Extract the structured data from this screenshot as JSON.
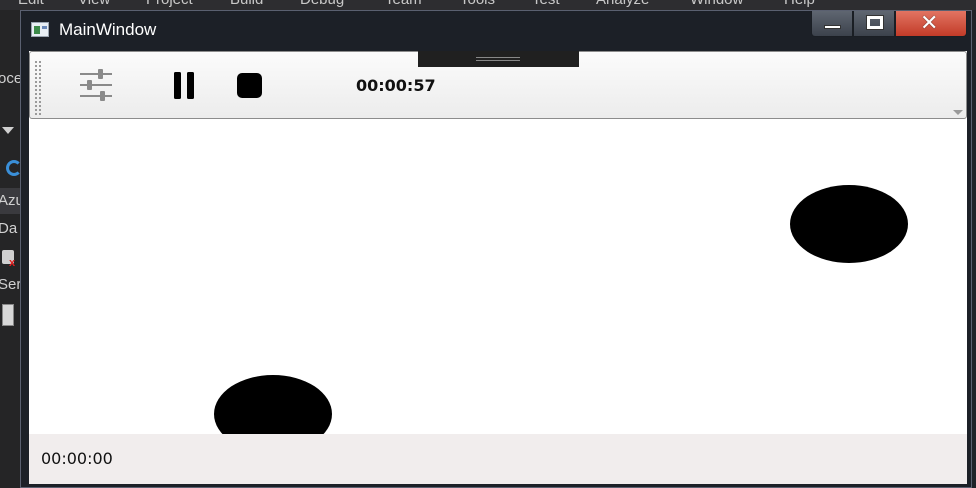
{
  "ide": {
    "menu": [
      "Edit",
      "View",
      "Project",
      "Build",
      "Debug",
      "Team",
      "Tools",
      "Test",
      "Analyze",
      "Window",
      "Help"
    ],
    "left_panel": [
      "oce",
      "Azu",
      "Da",
      "Ser"
    ]
  },
  "window": {
    "title": "MainWindow",
    "icons": {
      "app": "app-icon",
      "minimize": "minimize-icon",
      "maximize": "maximize-icon",
      "close": "close-icon"
    },
    "close_glyph": "✕"
  },
  "toolbar": {
    "buttons": [
      {
        "name": "settings",
        "icon": "sliders-icon"
      },
      {
        "name": "pause",
        "icon": "pause-icon"
      },
      {
        "name": "stop",
        "icon": "stop-icon"
      }
    ],
    "elapsed_time": "00:00:57"
  },
  "canvas": {
    "shapes": [
      {
        "type": "ellipse",
        "color": "#000000"
      },
      {
        "type": "ellipse",
        "color": "#000000"
      }
    ]
  },
  "status": {
    "time": "00:00:00"
  },
  "colors": {
    "close_button": "#d24b36",
    "window_chrome": "#1c2027",
    "status_bar": "#f1eded"
  }
}
